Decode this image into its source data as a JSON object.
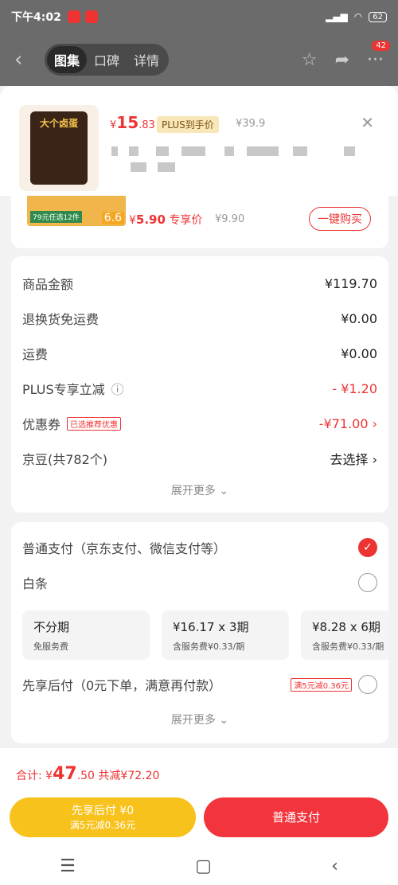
{
  "status": {
    "time": "下午4:02",
    "battery": "62"
  },
  "topbar": {
    "tabs": [
      "图集",
      "口碑",
      "详情"
    ],
    "badge": "42"
  },
  "product": {
    "price_sym": "¥",
    "price_int": "15",
    "price_dec": ".83",
    "plus_label": "PLUS到手价",
    "orig": "¥39.9",
    "bag_text": "大个卤蛋"
  },
  "rec": {
    "tag": "79元任选12件",
    "num": "6.6",
    "price_sym": "¥",
    "price": "5.90",
    "price_label": "专享价",
    "orig": "¥9.90",
    "buy": "一键购买"
  },
  "summary": {
    "rows": [
      {
        "k": "商品金额",
        "v": "¥119.70"
      },
      {
        "k": "退换货免运费",
        "v": "¥0.00"
      },
      {
        "k": "运费",
        "v": "¥0.00"
      },
      {
        "k": "PLUS专享立减",
        "v": "- ¥1.20"
      },
      {
        "k": "优惠券",
        "tag": "已选推荐优惠",
        "v": "-¥71.00 ›"
      },
      {
        "k": "京豆(共782个)",
        "v": "去选择 ›"
      }
    ],
    "more": "展开更多 ⌄"
  },
  "payment": {
    "normal": "普通支付（京东支付、微信支付等）",
    "baitiao": "白条",
    "options": [
      {
        "a": "不分期",
        "b": "免服务费"
      },
      {
        "a": "¥16.17 x 3期",
        "b": "含服务费¥0.33/期"
      },
      {
        "a": "¥8.28 x 6期",
        "b": "含服务费¥0.33/期"
      }
    ],
    "later": "先享后付（0元下单，满意再付款）",
    "later_tag": "满5元减0.36元",
    "more": "展开更多 ⌄"
  },
  "footer": {
    "total_label": "合计: ¥",
    "total_int": "47",
    "total_dec": ".50",
    "saved": "共减¥72.20",
    "btn1_a": "先享后付 ¥0",
    "btn1_b": "满5元减0.36元",
    "btn2": "普通支付"
  }
}
